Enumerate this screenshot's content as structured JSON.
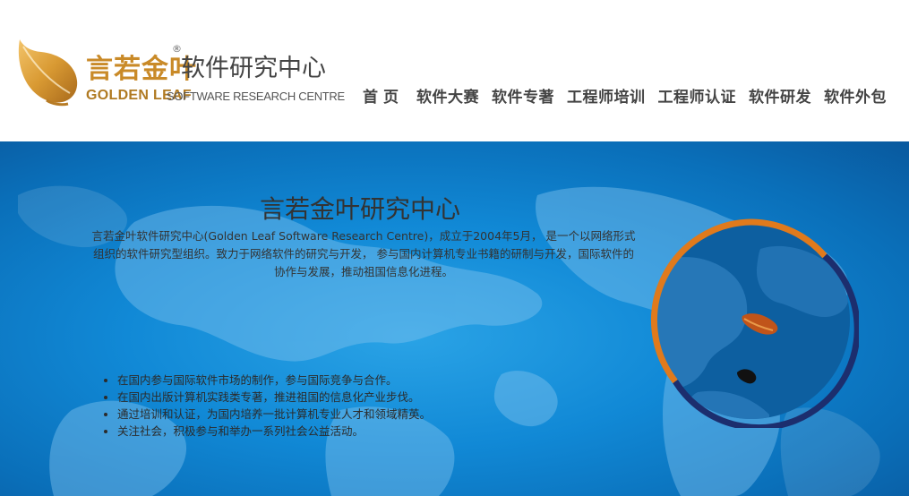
{
  "header": {
    "brand_cn": "言若金叶",
    "brand_reg": "®",
    "brand_sub": "软件研究中心",
    "brand_en_bold": "GOLDEN LEAF",
    "brand_en_rest": "SOFTWARE RESEARCH CENTRE"
  },
  "nav": {
    "items": [
      {
        "label": "首页"
      },
      {
        "label": "软件大赛"
      },
      {
        "label": "软件专著"
      },
      {
        "label": "工程师培训"
      },
      {
        "label": "工程师认证"
      },
      {
        "label": "软件研发"
      },
      {
        "label": "软件外包"
      }
    ]
  },
  "banner": {
    "title": "言若金叶研究中心",
    "intro": "言若金叶软件研究中心(Golden Leaf Software Research Centre)，成立于2004年5月， 是一个以网络形式组织的软件研究型组织。致力于网络软件的研究与开发， 参与国内计算机专业书籍的研制与开发，国际软件的协作与发展，推动祖国信息化进程。",
    "bullets": [
      "在国内参与国际软件市场的制作，参与国际竞争与合作。",
      "在国内出版计算机实践类专著，推进祖国的信息化产业步伐。",
      "通过培训和认证，为国内培养一批计算机专业人才和领域精英。",
      "关注社会，积极参与和举办一系列社会公益活动。"
    ]
  },
  "colors": {
    "brand_gold": "#c98a28",
    "banner_blue": "#1189d6",
    "ring_orange": "#e07a1c",
    "ring_navy": "#1c2e6e"
  },
  "icons": {
    "logo": "golden-leaf-logo",
    "globe": "globe-map-icon"
  }
}
